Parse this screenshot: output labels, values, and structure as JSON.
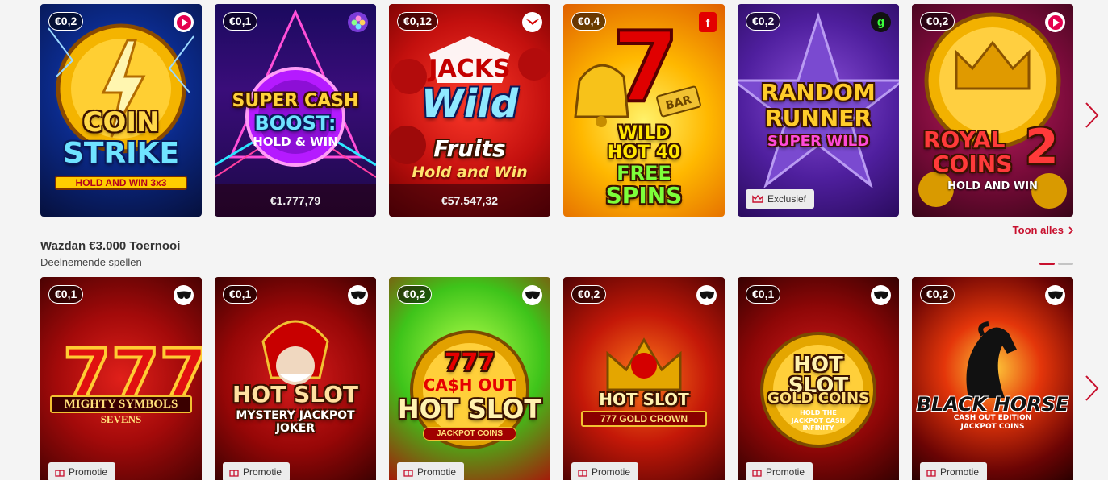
{
  "section1": {
    "see_all_label": "Toon alles",
    "games": [
      {
        "name": "COIN STRIKE",
        "sub": "HOLD AND WIN 3x3",
        "bet": "€0,2",
        "provider_icon": "play-logo-icon"
      },
      {
        "name": "SUPER CASH BOOST",
        "sub": "HOLD & WIN",
        "bet": "€0,1",
        "provider_icon": "blossom-logo-icon",
        "jackpot": "€1.777,79"
      },
      {
        "name": "JACKS Wild Fruits",
        "sub": "Hold and Win",
        "bet": "€0,12",
        "provider_icon": "bird-logo-icon",
        "jackpot": "€57.547,32"
      },
      {
        "name": "WILD HOT 40 FREE SPINS",
        "sub": "BAR",
        "bet": "€0,4",
        "provider_icon": "f-logo-icon"
      },
      {
        "name": "RANDOM RUNNER",
        "sub": "SUPER WILD",
        "bet": "€0,2",
        "provider_icon": "g-logo-icon",
        "badge": "Exclusief"
      },
      {
        "name": "ROYAL COINS 2",
        "sub": "HOLD AND WIN",
        "bet": "€0,2",
        "provider_icon": "play-logo-icon"
      }
    ]
  },
  "section2": {
    "title": "Wazdan €3.000 Toernooi",
    "subtitle": "Deelnemende spellen",
    "games": [
      {
        "name": "MIGHTY SYMBOLS",
        "sub": "SEVENS",
        "bet": "€0,1",
        "provider_icon": "wazdan-mask-icon",
        "badge": "Promotie"
      },
      {
        "name": "HOT SLOT",
        "sub": "MYSTERY JACKPOT JOKER",
        "bet": "€0,1",
        "provider_icon": "wazdan-mask-icon",
        "badge": "Promotie"
      },
      {
        "name": "777 CASH OUT HOT SLOT",
        "sub": "JACKPOT COINS",
        "bet": "€0,2",
        "provider_icon": "wazdan-mask-icon",
        "badge": "Promotie"
      },
      {
        "name": "HOT SLOT",
        "sub": "777 GOLD CROWN",
        "bet": "€0,2",
        "provider_icon": "wazdan-mask-icon",
        "badge": "Promotie"
      },
      {
        "name": "HOT SLOT GOLD COINS",
        "sub": "HOLD THE JACKPOT CASH INFINITY",
        "bet": "€0,1",
        "provider_icon": "wazdan-mask-icon",
        "badge": "Promotie"
      },
      {
        "name": "BLACK HORSE",
        "sub": "CASH OUT EDITION JACKPOT COINS",
        "bet": "€0,2",
        "provider_icon": "wazdan-mask-icon",
        "badge": "Promotie"
      }
    ]
  },
  "colors": {
    "accent": "#c8102e",
    "bet_badge_bg": "#1a1a1a"
  }
}
